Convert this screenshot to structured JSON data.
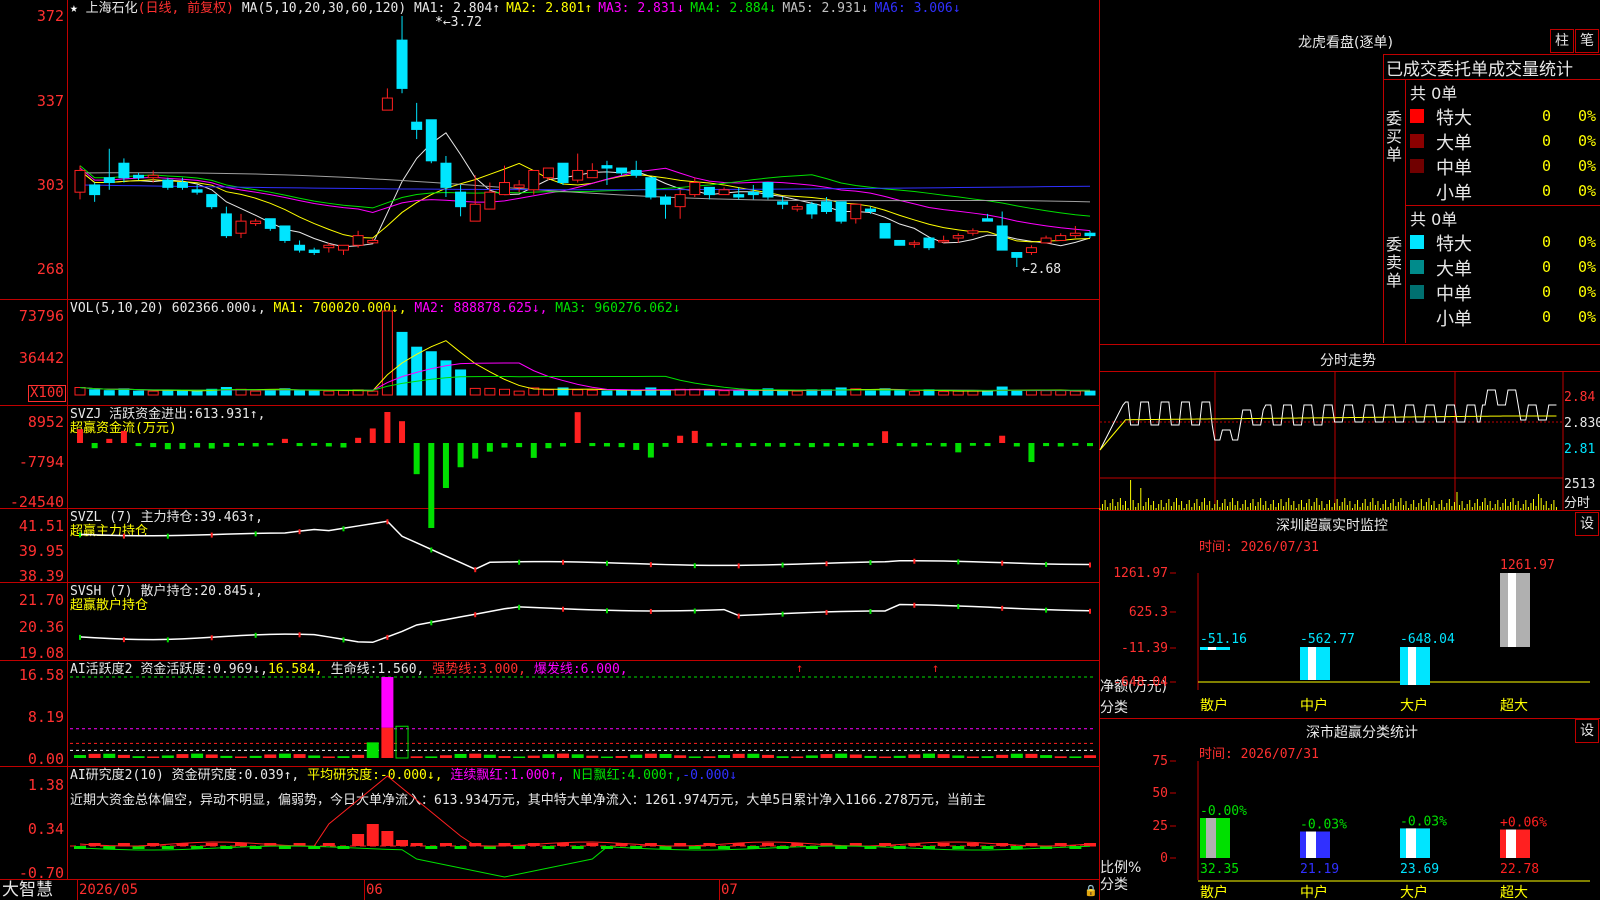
{
  "colors": {
    "up": "#ff2020",
    "down": "#00e5ff",
    "grid": "#c00000",
    "white": "#e8e8e8",
    "yellow": "#ffff00",
    "magenta": "#ff00ff",
    "green": "#00e000",
    "blue": "#3030ff",
    "label": "#ff3030"
  },
  "price": {
    "title": "上海石化",
    "mode": "(日线, 前复权)",
    "ma_params": "MA(5,10,20,30,60,120)",
    "ma": [
      {
        "label": "MA1:",
        "value": "2.804↑",
        "color": "#e8e8e8"
      },
      {
        "label": "MA2:",
        "value": "2.801↑",
        "color": "#ffff00"
      },
      {
        "label": "MA3:",
        "value": "2.831↓",
        "color": "#ff00ff"
      },
      {
        "label": "MA4:",
        "value": "2.884↓",
        "color": "#00e000"
      },
      {
        "label": "MA5:",
        "value": "2.931↓",
        "color": "#c0c0c0"
      },
      {
        "label": "MA6:",
        "value": "3.006↓",
        "color": "#3030ff"
      }
    ],
    "yticks": [
      "3.72",
      "3.37",
      "3.03",
      "2.68"
    ],
    "yticks_display": [
      "372",
      "337",
      "303",
      "268"
    ],
    "high_label": "3.72",
    "low_label": "←2.68",
    "candles": [
      [
        2.99,
        3.08,
        3.1,
        2.96
      ],
      [
        3.02,
        2.98,
        3.03,
        2.95
      ],
      [
        3.05,
        3.03,
        3.17,
        3.0
      ],
      [
        3.11,
        3.05,
        3.13,
        3.03
      ],
      [
        3.06,
        3.05,
        3.07,
        3.04
      ],
      [
        3.05,
        3.06,
        3.08,
        3.03
      ],
      [
        3.04,
        3.01,
        3.05,
        3.0
      ],
      [
        3.03,
        3.01,
        3.05,
        3.0
      ],
      [
        3.0,
        2.99,
        3.02,
        2.98
      ],
      [
        2.98,
        2.93,
        2.98,
        2.92
      ],
      [
        2.9,
        2.81,
        2.93,
        2.8
      ],
      [
        2.82,
        2.87,
        2.9,
        2.8
      ],
      [
        2.86,
        2.87,
        2.88,
        2.85
      ],
      [
        2.88,
        2.84,
        2.88,
        2.83
      ],
      [
        2.85,
        2.79,
        2.85,
        2.78
      ],
      [
        2.77,
        2.75,
        2.79,
        2.74
      ],
      [
        2.75,
        2.74,
        2.76,
        2.73
      ],
      [
        2.76,
        2.77,
        2.78,
        2.74
      ],
      [
        2.75,
        2.77,
        2.77,
        2.73
      ],
      [
        2.77,
        2.81,
        2.83,
        2.76
      ],
      [
        2.78,
        2.79,
        2.8,
        2.78
      ],
      [
        3.33,
        3.38,
        3.42,
        3.33
      ],
      [
        3.62,
        3.42,
        3.72,
        3.4
      ],
      [
        3.28,
        3.25,
        3.36,
        3.21
      ],
      [
        3.29,
        3.12,
        3.29,
        3.11
      ],
      [
        3.11,
        3.01,
        3.14,
        2.97
      ],
      [
        2.99,
        2.93,
        3.02,
        2.89
      ],
      [
        2.87,
        2.94,
        3.06,
        2.88
      ],
      [
        2.92,
        2.99,
        3.03,
        2.92
      ],
      [
        2.98,
        3.03,
        3.1,
        2.98
      ],
      [
        3.01,
        3.02,
        3.04,
        2.99
      ],
      [
        3.0,
        3.08,
        3.08,
        2.98
      ],
      [
        3.05,
        3.09,
        3.08,
        3.04
      ],
      [
        3.11,
        3.03,
        3.08,
        3.02
      ],
      [
        3.04,
        3.08,
        3.15,
        3.03
      ],
      [
        3.05,
        3.08,
        3.11,
        3.05
      ],
      [
        3.1,
        3.09,
        3.12,
        3.02
      ],
      [
        3.09,
        3.07,
        3.06,
        3.08
      ],
      [
        3.08,
        3.06,
        3.12,
        3.05
      ],
      [
        3.05,
        2.97,
        3.05,
        2.96
      ],
      [
        2.97,
        2.94,
        2.98,
        2.88
      ],
      [
        2.93,
        2.98,
        3.0,
        2.88
      ],
      [
        2.98,
        3.03,
        3.05,
        2.97
      ],
      [
        3.01,
        2.98,
        3.01,
        2.96
      ],
      [
        2.98,
        3.0,
        3.01,
        2.98
      ],
      [
        2.98,
        2.97,
        3.01,
        2.96
      ],
      [
        2.99,
        2.98,
        3.02,
        2.96
      ],
      [
        3.03,
        2.97,
        3.03,
        2.96
      ],
      [
        2.95,
        2.94,
        2.97,
        2.92
      ],
      [
        2.92,
        2.93,
        2.94,
        2.91
      ],
      [
        2.94,
        2.9,
        2.95,
        2.88
      ],
      [
        2.95,
        2.91,
        2.97,
        2.9
      ],
      [
        2.95,
        2.87,
        2.94,
        2.86
      ],
      [
        2.88,
        2.94,
        2.93,
        2.86
      ],
      [
        2.92,
        2.91,
        2.93,
        2.9
      ],
      [
        2.86,
        2.8,
        2.86,
        2.8
      ],
      [
        2.79,
        2.77,
        2.79,
        2.77
      ],
      [
        2.78,
        2.78,
        2.79,
        2.76
      ],
      [
        2.8,
        2.76,
        2.8,
        2.75
      ],
      [
        2.79,
        2.79,
        2.81,
        2.78
      ],
      [
        2.8,
        2.81,
        2.82,
        2.78
      ],
      [
        2.82,
        2.83,
        2.84,
        2.81
      ],
      [
        2.88,
        2.87,
        2.9,
        2.87
      ],
      [
        2.85,
        2.75,
        2.91,
        2.75
      ],
      [
        2.74,
        2.72,
        2.74,
        2.68
      ],
      [
        2.74,
        2.76,
        2.77,
        2.73
      ],
      [
        2.78,
        2.8,
        2.81,
        2.78
      ],
      [
        2.79,
        2.81,
        2.82,
        2.79
      ],
      [
        2.81,
        2.82,
        2.85,
        2.8
      ],
      [
        2.82,
        2.81,
        2.83,
        2.8
      ]
    ]
  },
  "vol": {
    "params": "VOL(5,10,20)",
    "value": "602366.000↓,",
    "ma1": "MA1: 700020.000↓,",
    "ma2": "MA2: 888878.625↓,",
    "ma3": "MA3: 960276.062↓",
    "yticks": [
      "73796",
      "36442"
    ],
    "unit": "X100"
  },
  "svzj": {
    "params": "SVZJ",
    "label": "活跃资金进出:",
    "value": "613.931↑,",
    "sub": "超赢资金流(万元)",
    "yticks": [
      "8952",
      "-7794",
      "-24540"
    ]
  },
  "svzl": {
    "params": "SVZL (7)",
    "label": "主力持仓:",
    "value": "39.463↑,",
    "sub": "超赢主力持仓",
    "yticks": [
      "41.51",
      "39.95",
      "38.39"
    ]
  },
  "svsh": {
    "params": "SVSH (7)",
    "label": "散户持仓:",
    "value": "20.845↓,",
    "sub": "超赢散户持仓",
    "yticks": [
      "21.70",
      "20.36",
      "19.08"
    ]
  },
  "ai1": {
    "params": "AI活跃度2",
    "label": "资金活跃度:",
    "value": "0.969↓,",
    "v2": "16.584,",
    "l3": "生命线:",
    "v3": "1.560,",
    "l4": "强势线:",
    "v4": "3.000,",
    "l5": "爆发线:",
    "v5": "6.000,",
    "yticks": [
      "16.58",
      "8.19",
      "0.00"
    ]
  },
  "ai2": {
    "params": "AI研究度2(10)",
    "label": "资金研究度:",
    "value": "0.039↑,",
    "l2": "平均研究度:",
    "v2": "-0.000↓,",
    "l3": "连续飘红:",
    "v3": "1.000↑,",
    "l4": "N日飘红:",
    "v4": "4.000↑,",
    "v5": "-0.000↓",
    "text": "近期大资金总体偏空，异动不明显，偏弱势，今日大单净流入：613.934万元，其中特大单净流入：1261.974万元，大单5日累计净入1166.278万元，当前主",
    "yticks": [
      "1.38",
      "0.34",
      "-0.70"
    ]
  },
  "xaxis": {
    "logo": "大智慧",
    "ticks": [
      "2026/05",
      "06",
      "07"
    ]
  },
  "longhu": {
    "title": "龙虎看盘(逐单)",
    "btn1": "柱",
    "btn2": "笔",
    "header": "已成交委托单成交量统计",
    "buy": {
      "side": "委买单",
      "total": "共 0单",
      "rows": [
        {
          "name": "特大",
          "n": "0",
          "pct": "0%",
          "color": "#ff0000"
        },
        {
          "name": "大单",
          "n": "0",
          "pct": "0%",
          "color": "#8b0000"
        },
        {
          "name": "中单",
          "n": "0",
          "pct": "0%",
          "color": "#700000"
        },
        {
          "name": "小单",
          "n": "0",
          "pct": "0%",
          "color": "#000000"
        }
      ]
    },
    "sell": {
      "side": "委卖单",
      "total": "共 0单",
      "rows": [
        {
          "name": "特大",
          "n": "0",
          "pct": "0%",
          "color": "#00e5ff"
        },
        {
          "name": "大单",
          "n": "0",
          "pct": "0%",
          "color": "#008b8b"
        },
        {
          "name": "中单",
          "n": "0",
          "pct": "0%",
          "color": "#007070"
        },
        {
          "name": "小单",
          "n": "0",
          "pct": "0%",
          "color": "#000000"
        }
      ]
    }
  },
  "fenshi": {
    "title": "分时走势",
    "prices": [
      "2.84",
      "2.830",
      "2.81"
    ],
    "vol": "2513",
    "unit": "分时"
  },
  "monitor": {
    "title": "深圳超赢实时监控",
    "btn": "设",
    "time": "时间: 2026/07/31",
    "yticks": [
      "1261.97",
      "625.3",
      "-11.39",
      "-648.04"
    ],
    "ylabel": "净额(万元)",
    "xlabel": "分类",
    "cats": [
      "散户",
      "中户",
      "大户",
      "超大"
    ],
    "values": [
      -51.16,
      -562.77,
      -648.04,
      1261.97
    ],
    "labels": [
      "-51.16",
      "-562.77",
      "-648.04",
      "1261.97"
    ]
  },
  "classify": {
    "title": "深市超赢分类统计",
    "btn": "设",
    "time": "时间: 2026/07/31",
    "yticks": [
      "75",
      "50",
      "25",
      "0"
    ],
    "ylabel": "比例%",
    "xlabel": "分类",
    "cats": [
      "散户",
      "中户",
      "大户",
      "超大"
    ],
    "top": [
      "-0.00%",
      "-0.03%",
      "-0.03%",
      "+0.06%"
    ],
    "values": [
      32.35,
      21.19,
      23.69,
      22.78
    ],
    "bottom": [
      "32.35",
      "21.19",
      "23.69",
      "22.78"
    ]
  }
}
